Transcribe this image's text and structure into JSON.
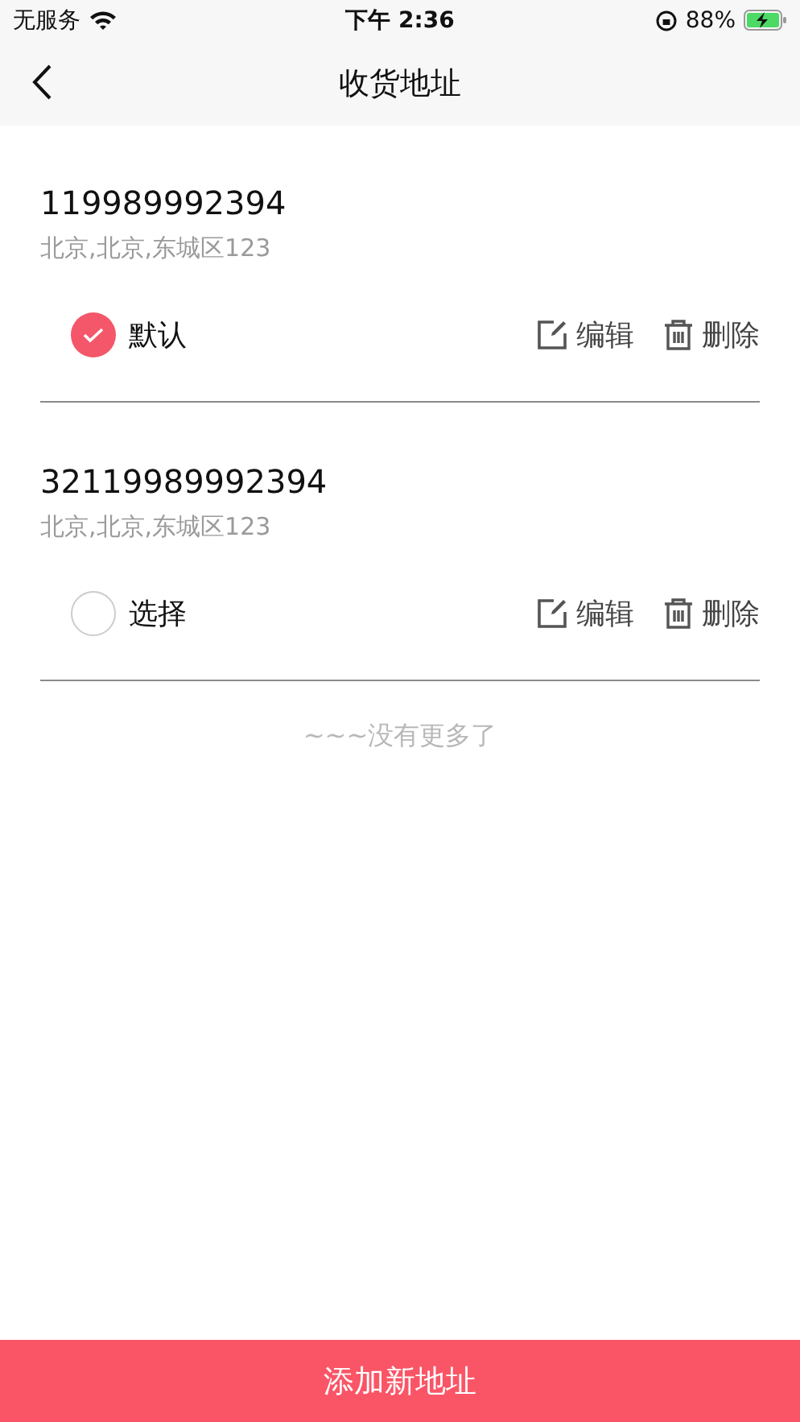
{
  "status_bar": {
    "carrier": "无服务",
    "time": "下午 2:36",
    "battery": "88%"
  },
  "nav": {
    "title": "收货地址"
  },
  "addresses": [
    {
      "phone": "119989992394",
      "address": "北京,北京,东城区123",
      "selected": true,
      "choice_label": "默认",
      "edit": "编辑",
      "delete": "删除"
    },
    {
      "phone": "32119989992394",
      "address": "北京,北京,东城区123",
      "selected": false,
      "choice_label": "选择",
      "edit": "编辑",
      "delete": "删除"
    }
  ],
  "end_note": "~~~没有更多了",
  "add_button": "添加新地址"
}
